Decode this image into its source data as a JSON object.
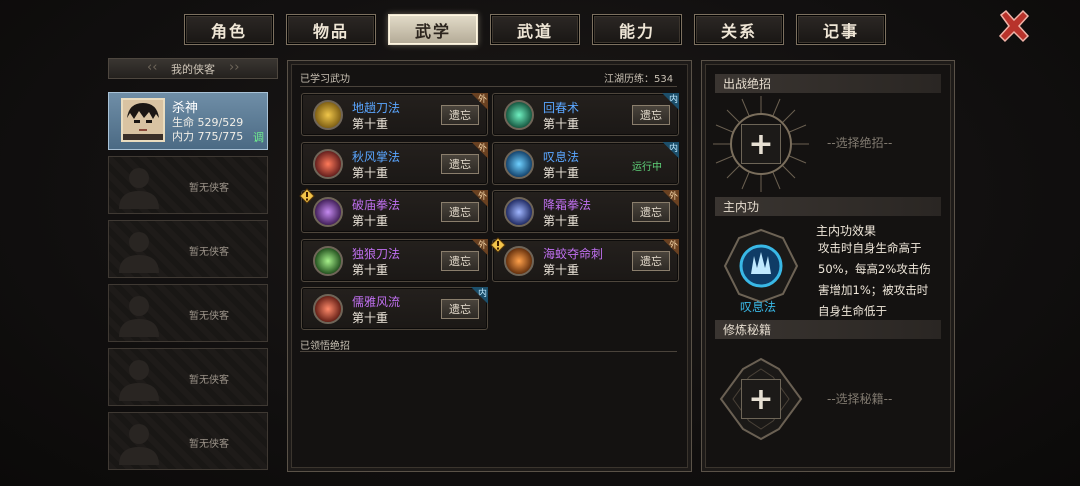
{
  "tabs": [
    {
      "label": "角色"
    },
    {
      "label": "物品"
    },
    {
      "label": "武学"
    },
    {
      "label": "武道"
    },
    {
      "label": "能力"
    },
    {
      "label": "关系"
    },
    {
      "label": "记事"
    }
  ],
  "active_tab": "武学",
  "roster": {
    "title": "我的侠客",
    "selected": {
      "name": "杀神",
      "hp": "生命 529/529",
      "mp": "内力 775/775",
      "adjust": "调"
    },
    "empty_label": "暂无侠客"
  },
  "skills_panel": {
    "title": "已学习武功",
    "experience": "江湖历练：534",
    "forget_label": "遗忘",
    "running_label": "运行中",
    "skills": [
      {
        "name": "地趟刀法",
        "level": "第十重",
        "tag": "外",
        "color": "#5aa6ff",
        "icon": "blade-icon",
        "warn": false,
        "running": false
      },
      {
        "name": "回春术",
        "level": "第十重",
        "tag": "内",
        "color": "#5aa6ff",
        "icon": "healing-icon",
        "warn": false,
        "running": false
      },
      {
        "name": "秋风掌法",
        "level": "第十重",
        "tag": "外",
        "color": "#5aa6ff",
        "icon": "palm-icon",
        "warn": false,
        "running": false
      },
      {
        "name": "叹息法",
        "level": "第十重",
        "tag": "内",
        "color": "#5aa6ff",
        "icon": "sigh-icon",
        "warn": false,
        "running": true
      },
      {
        "name": "破庙拳法",
        "level": "第十重",
        "tag": "外",
        "color": "#c070f0",
        "icon": "fist-icon",
        "warn": true,
        "running": false
      },
      {
        "name": "降霜拳法",
        "level": "第十重",
        "tag": "外",
        "color": "#c070f0",
        "icon": "frost-icon",
        "warn": false,
        "running": false
      },
      {
        "name": "独狼刀法",
        "level": "第十重",
        "tag": "外",
        "color": "#c070f0",
        "icon": "wolf-blade-icon",
        "warn": false,
        "running": false
      },
      {
        "name": "海蛟夺命刺",
        "level": "第十重",
        "tag": "外",
        "color": "#c070f0",
        "icon": "flame-icon",
        "warn": true,
        "running": false
      },
      {
        "name": "儒雅风流",
        "level": "第十重",
        "tag": "内",
        "color": "#c070f0",
        "icon": "scholar-icon",
        "warn": false,
        "running": false
      }
    ],
    "ultimates_title": "已领悟绝招"
  },
  "right_panel": {
    "ultimate_header": "出战绝招",
    "ultimate_hint": "--选择绝招--",
    "main_header": "主内功",
    "main_skill_name": "叹息法",
    "effect_title": "主内功效果",
    "effect_text": "攻击时自身生命高于50%，每高2%攻击伤害增加1%；被攻击时自身生命低于",
    "manual_header": "修炼秘籍",
    "manual_hint": "--选择秘籍--"
  },
  "colors": {
    "internal_blue": "#39b8e6",
    "running_green": "#5fd37a",
    "tab_active": "#d9d1bd"
  }
}
